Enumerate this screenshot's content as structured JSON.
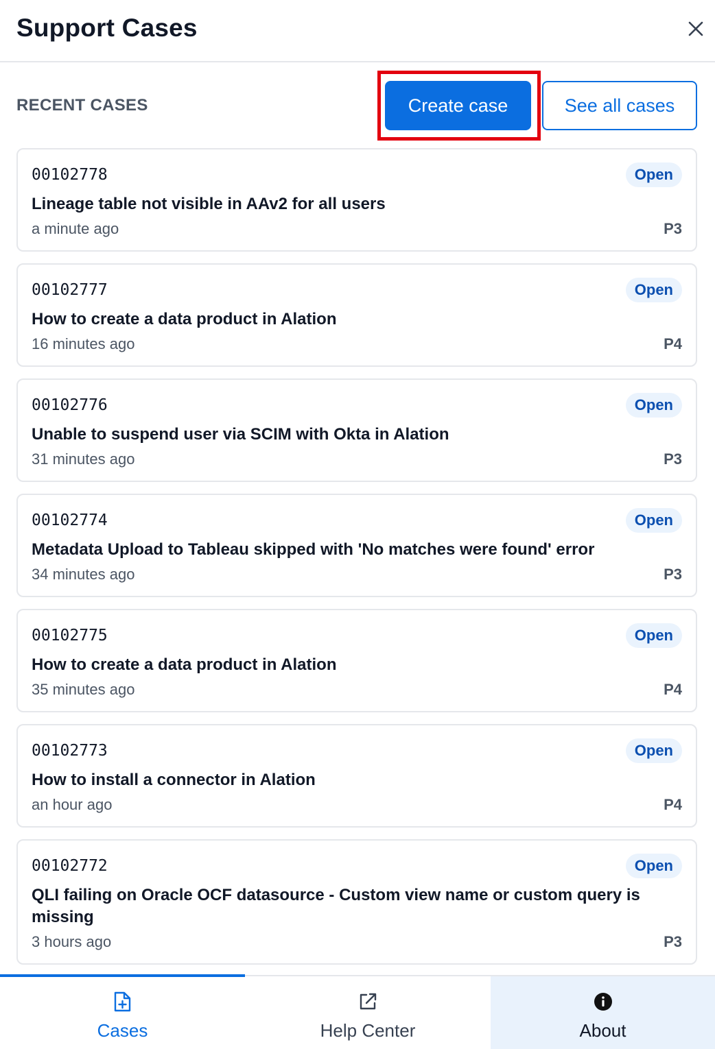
{
  "header": {
    "title": "Support Cases"
  },
  "toolbar": {
    "section_label": "RECENT CASES",
    "create_label": "Create case",
    "see_all_label": "See all cases"
  },
  "cases": [
    {
      "number": "00102778",
      "status": "Open",
      "subject": "Lineage table not visible in AAv2 for all users",
      "time": "a minute ago",
      "priority": "P3"
    },
    {
      "number": "00102777",
      "status": "Open",
      "subject": "How to create a data product in Alation",
      "time": "16 minutes ago",
      "priority": "P4"
    },
    {
      "number": "00102776",
      "status": "Open",
      "subject": "Unable to suspend user via SCIM with Okta in Alation",
      "time": "31 minutes ago",
      "priority": "P3"
    },
    {
      "number": "00102774",
      "status": "Open",
      "subject": "Metadata Upload to Tableau skipped with 'No matches were found' error",
      "time": "34 minutes ago",
      "priority": "P3"
    },
    {
      "number": "00102775",
      "status": "Open",
      "subject": "How to create a data product in Alation",
      "time": "35 minutes ago",
      "priority": "P4"
    },
    {
      "number": "00102773",
      "status": "Open",
      "subject": "How to install a connector in Alation",
      "time": "an hour ago",
      "priority": "P4"
    },
    {
      "number": "00102772",
      "status": "Open",
      "subject": "QLI failing on Oracle OCF datasource - Custom view name or custom query is missing",
      "time": "3 hours ago",
      "priority": "P3"
    }
  ],
  "tabs": [
    {
      "label": "Cases",
      "icon": "file-plus-icon"
    },
    {
      "label": "Help Center",
      "icon": "external-link-icon"
    },
    {
      "label": "About",
      "icon": "info-icon"
    }
  ],
  "colors": {
    "accent": "#0b6ee0",
    "highlight": "#e3000f",
    "badge_bg": "#eaf3fd",
    "badge_text": "#0b4fb0",
    "about_tab_bg": "#e9f2fc"
  }
}
